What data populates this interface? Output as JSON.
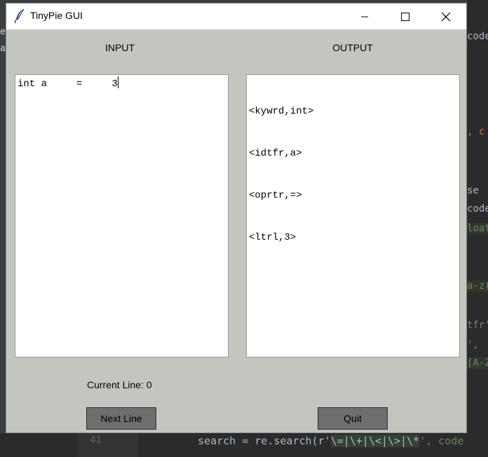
{
  "window": {
    "title": "TinyPie GUI"
  },
  "labels": {
    "input": "INPUT",
    "output": "OUTPUT",
    "current_line_prefix": "Current Line:",
    "current_line_value": "0"
  },
  "input_text": {
    "line1_before_caret": "int a     =     3",
    "line1_after_caret": ""
  },
  "output_lines": [
    "<kywrd,int>",
    "<idtfr,a>",
    "<oprtr,=>",
    "<ltrl,3>"
  ],
  "buttons": {
    "next_line": "Next Line",
    "quit": "Quit"
  },
  "background_ide": {
    "line_number": "41",
    "code_prefix": "search = re.search(r'",
    "code_regex": "\\=|\\+|\\<|\\>|\\*",
    "code_suffix": "', code",
    "right_fragments": [
      "code",
      ", c",
      "se",
      "code",
      "loat",
      "a-z(",
      "tfr'",
      "',",
      "[A-Z"
    ],
    "left_fragments": [
      "e",
      "a"
    ]
  },
  "colors": {
    "window_bg": "#c5c5c0",
    "button_bg": "#6e6e6e",
    "ide_bg": "#2b2b2b"
  },
  "icons": {
    "app": "feather-icon",
    "minimize": "minimize-icon",
    "maximize": "maximize-icon",
    "close": "close-icon"
  }
}
